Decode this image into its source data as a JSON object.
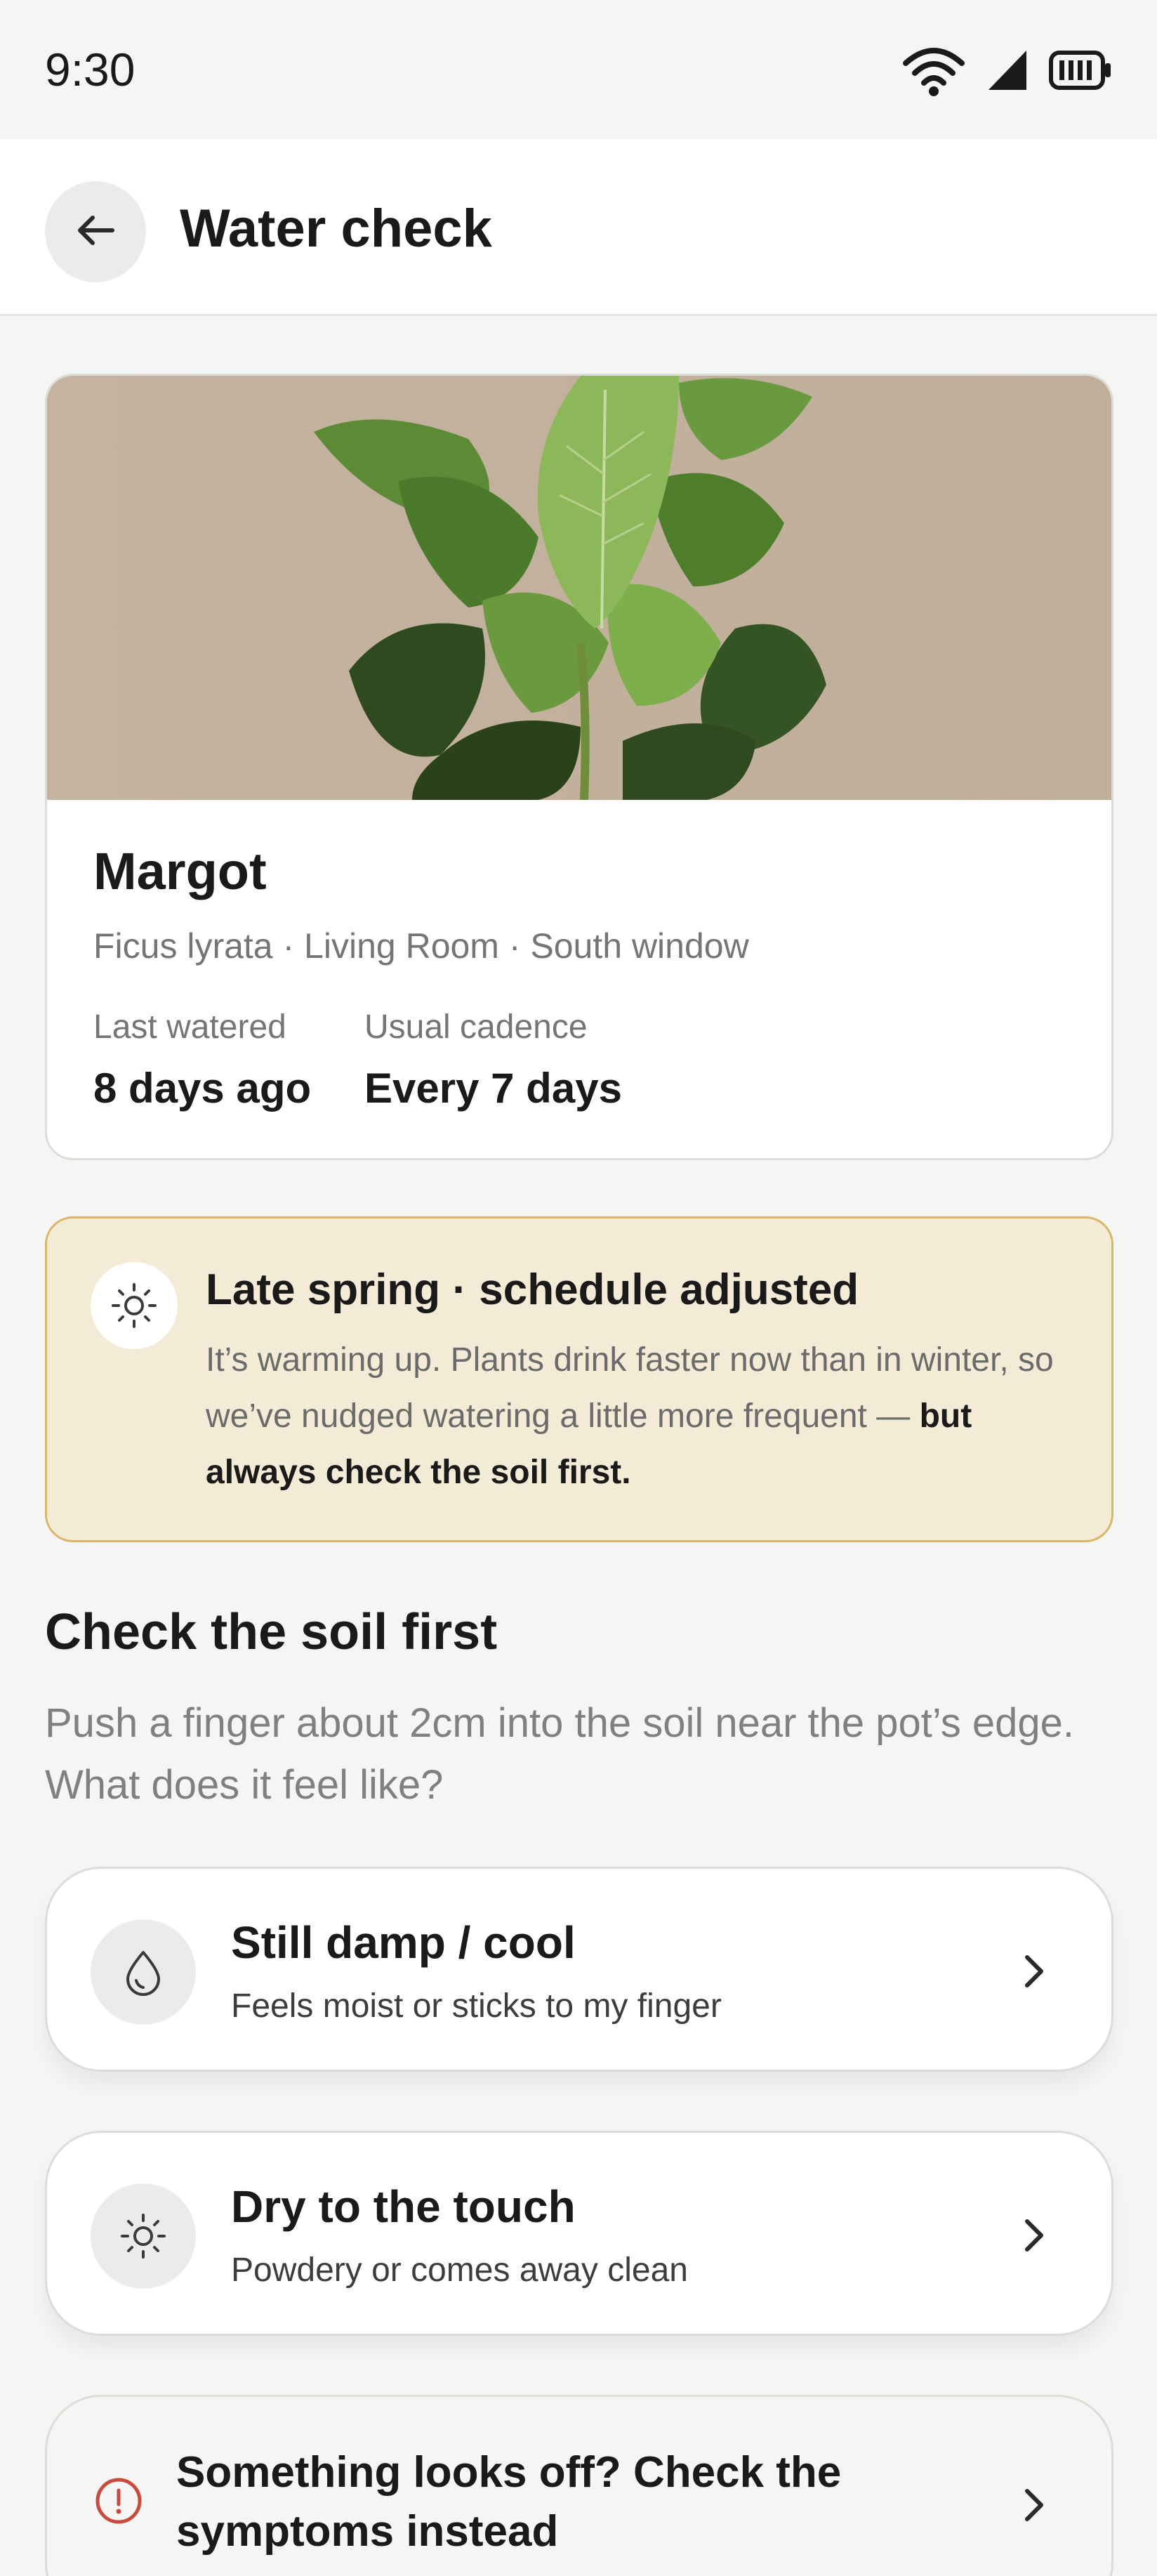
{
  "status_bar": {
    "time": "9:30",
    "icons": [
      "wifi-icon",
      "signal-icon",
      "battery-icon"
    ]
  },
  "app_bar": {
    "title": "Water check",
    "back_icon": "arrow-left-icon"
  },
  "plant": {
    "name": "Margot",
    "subtitle": "Ficus lyrata · Living Room · South window",
    "stats": [
      {
        "label": "Last watered",
        "value": "8 days ago"
      },
      {
        "label": "Usual cadence",
        "value": "Every 7 days"
      }
    ]
  },
  "season": {
    "icon": "sun-icon",
    "title": "Late spring · schedule adjusted",
    "body_plain": "It’s warming up. Plants drink faster now than in winter, so we’ve nudged watering a little more frequent — ",
    "body_bold": "but always check the soil first."
  },
  "soil_check": {
    "title": "Check the soil first",
    "description": "Push a finger about 2cm into the soil near the pot’s edge. What does it feel like?",
    "options": [
      {
        "icon": "droplet-icon",
        "title": "Still damp / cool",
        "subtitle": "Feels moist or sticks to my finger"
      },
      {
        "icon": "sun-icon",
        "title": "Dry to the touch",
        "subtitle": "Powdery or comes away clean"
      }
    ]
  },
  "symptoms_link": {
    "icon": "info-icon",
    "label": "Something looks off? Check the symptoms instead"
  },
  "colors": {
    "background": "#f5f5f3",
    "banner_background": "#f4ebd7",
    "banner_border": "#d8b766",
    "info_red": "#c94a3f"
  }
}
